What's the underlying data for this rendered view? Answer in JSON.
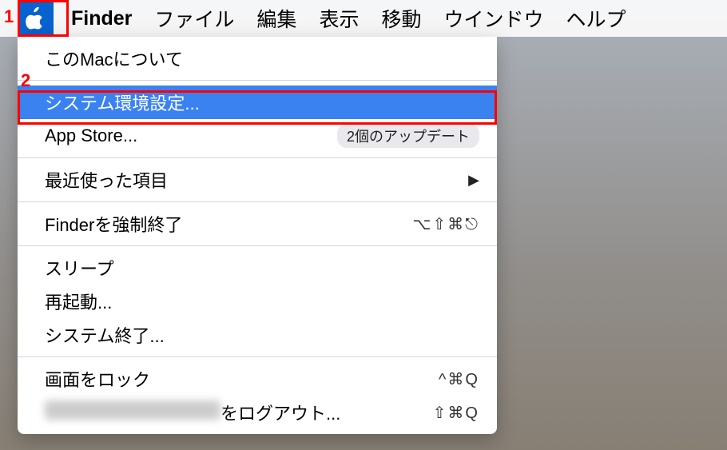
{
  "menubar": {
    "app_name": "Finder",
    "items": [
      "ファイル",
      "編集",
      "表示",
      "移動",
      "ウインドウ",
      "ヘルプ"
    ]
  },
  "apple_menu": {
    "about": "このMacについて",
    "system_prefs": "システム環境設定...",
    "app_store": "App Store...",
    "app_store_badge": "2個のアップデート",
    "recent_items": "最近使った項目",
    "force_quit": "Finderを強制終了",
    "force_quit_shortcut": "⌥⇧⌘⎋",
    "sleep": "スリープ",
    "restart": "再起動...",
    "shutdown": "システム終了...",
    "lock_screen": "画面をロック",
    "lock_screen_shortcut": "^⌘Q",
    "logout_suffix": "をログアウト...",
    "logout_shortcut": "⇧⌘Q"
  },
  "annotations": {
    "one": "1",
    "two": "2"
  }
}
